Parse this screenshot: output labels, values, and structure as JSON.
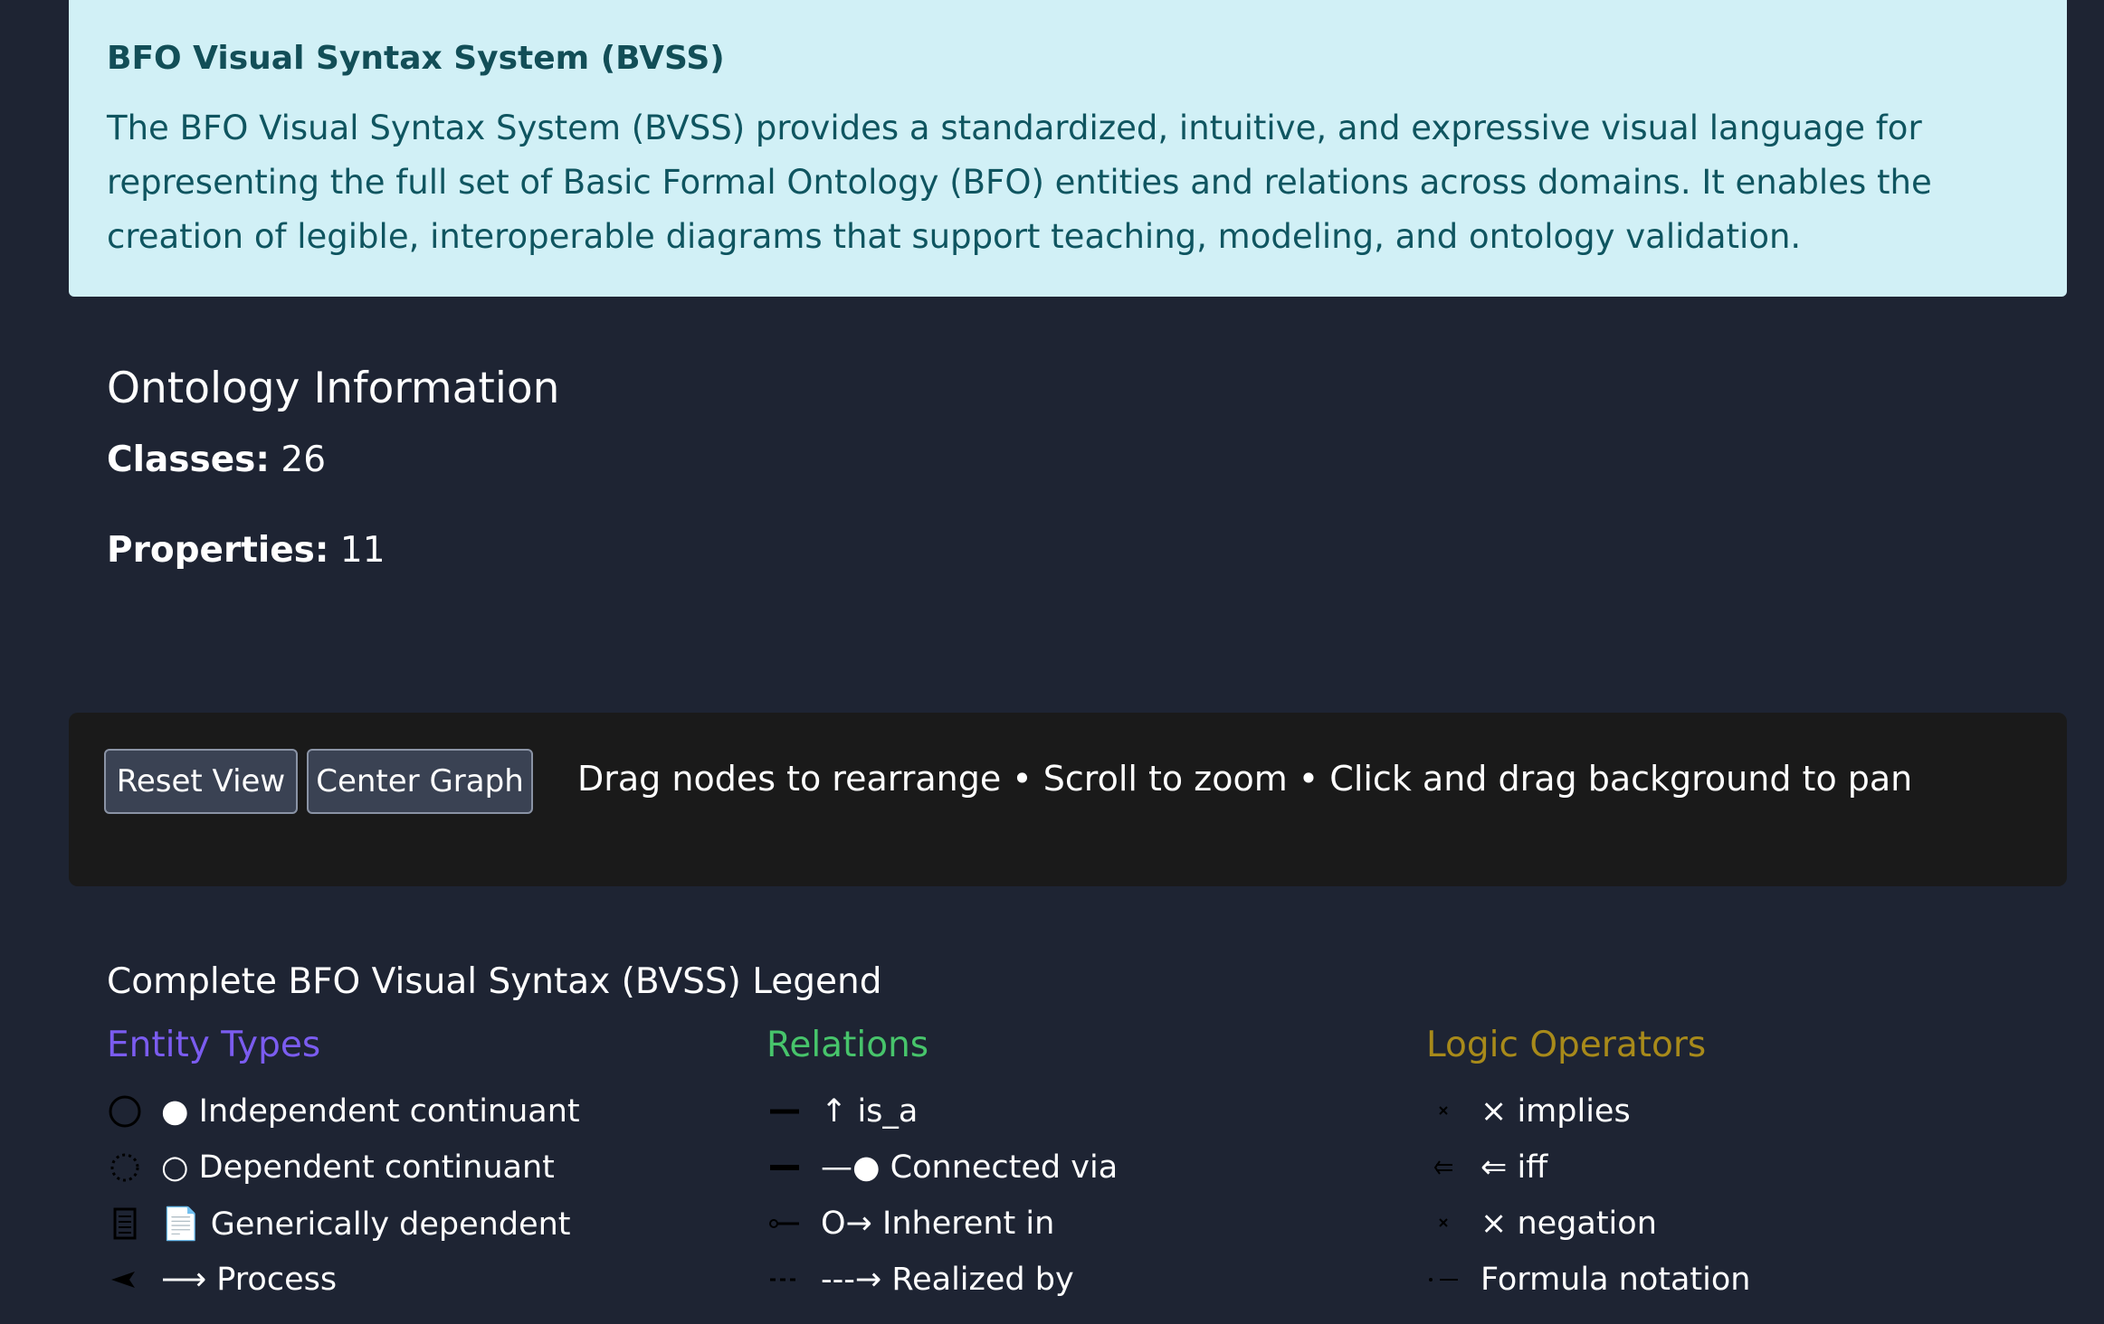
{
  "banner": {
    "title": "BFO Visual Syntax System (BVSS)",
    "text": "The BFO Visual Syntax System (BVSS) provides a standardized, intuitive, and expressive visual language for representing the full set of Basic Formal Ontology (BFO) entities and relations across domains. It enables the creation of legible, interoperable diagrams that support teaching, modeling, and ontology validation."
  },
  "ontology": {
    "heading": "Ontology Information",
    "classes_label": "Classes:",
    "classes_value": "26",
    "properties_label": "Properties:",
    "properties_value": "11"
  },
  "controls": {
    "reset_label": "Reset View",
    "center_label": "Center Graph",
    "hint": "Drag nodes to rearrange • Scroll to zoom • Click and drag background to pan"
  },
  "legend": {
    "title": "Complete BFO Visual Syntax (BVSS) Legend",
    "entity_types": {
      "title": "Entity Types",
      "color": "#7b5cf0",
      "items": [
        {
          "icon": "solid-circle-icon",
          "label": "● Independent continuant"
        },
        {
          "icon": "dotted-circle-icon",
          "label": "○ Dependent continuant"
        },
        {
          "icon": "document-icon",
          "label": "📄 Generically dependent"
        },
        {
          "icon": "arrowhead-icon",
          "label": "⟶ Process"
        }
      ]
    },
    "relations": {
      "title": "Relations",
      "color": "#47c46b",
      "items": [
        {
          "icon": "solid-line-icon",
          "label": "↑ is_a"
        },
        {
          "icon": "thick-line-icon",
          "label": "—● Connected via"
        },
        {
          "icon": "circle-line-icon",
          "label": "O→ Inherent in"
        },
        {
          "icon": "dashed-line-icon",
          "label": "---→ Realized by"
        }
      ]
    },
    "logic_operators": {
      "title": "Logic Operators",
      "color": "#a88a1a",
      "items": [
        {
          "icon": "cross-icon",
          "label": "× implies"
        },
        {
          "icon": "double-arrow-icon",
          "label": "⇐ iff"
        },
        {
          "icon": "cross-icon",
          "label": "× negation"
        },
        {
          "icon": "formula-icon",
          "label": "Formula notation"
        }
      ]
    }
  }
}
